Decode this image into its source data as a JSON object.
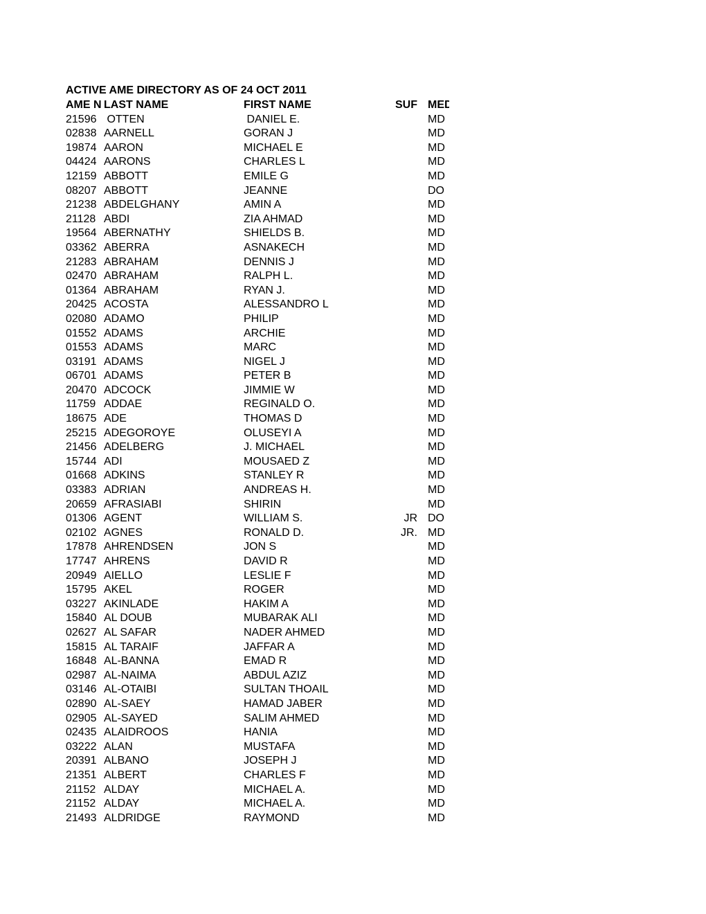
{
  "document": {
    "title": "ACTIVE AME DIRECTORY AS OF 24 OCT 2011",
    "columns": {
      "ame_no": "AME NO",
      "last_name": "LAST NAME",
      "first_name": "FIRST NAME",
      "suffix": "SUF",
      "medical_degree": "MED"
    },
    "rows": [
      {
        "ame_no": "21596",
        "last_name": " OTTEN",
        "first_name": " DANIEL E.",
        "suffix": "",
        "degree": "MD"
      },
      {
        "ame_no": "02838",
        "last_name": "AARNELL",
        "first_name": "GORAN J",
        "suffix": "",
        "degree": "MD"
      },
      {
        "ame_no": "19874",
        "last_name": "AARON",
        "first_name": "MICHAEL E",
        "suffix": "",
        "degree": "MD"
      },
      {
        "ame_no": "04424",
        "last_name": "AARONS",
        "first_name": "CHARLES L",
        "suffix": "",
        "degree": "MD"
      },
      {
        "ame_no": "12159",
        "last_name": "ABBOTT",
        "first_name": "EMILE G",
        "suffix": "",
        "degree": "MD"
      },
      {
        "ame_no": "08207",
        "last_name": "ABBOTT",
        "first_name": "JEANNE",
        "suffix": "",
        "degree": "DO"
      },
      {
        "ame_no": "21238",
        "last_name": "ABDELGHANY",
        "first_name": "AMIN A",
        "suffix": "",
        "degree": "MD"
      },
      {
        "ame_no": "21128",
        "last_name": "ABDI",
        "first_name": "ZIA AHMAD",
        "suffix": "",
        "degree": "MD"
      },
      {
        "ame_no": "19564",
        "last_name": "ABERNATHY",
        "first_name": "SHIELDS B.",
        "suffix": "",
        "degree": "MD"
      },
      {
        "ame_no": "03362",
        "last_name": "ABERRA",
        "first_name": "ASNAKECH",
        "suffix": "",
        "degree": "MD"
      },
      {
        "ame_no": "21283",
        "last_name": "ABRAHAM",
        "first_name": "DENNIS J",
        "suffix": "",
        "degree": "MD"
      },
      {
        "ame_no": "02470",
        "last_name": "ABRAHAM",
        "first_name": "RALPH L.",
        "suffix": "",
        "degree": "MD"
      },
      {
        "ame_no": "01364",
        "last_name": "ABRAHAM",
        "first_name": "RYAN J.",
        "suffix": "",
        "degree": "MD"
      },
      {
        "ame_no": "20425",
        "last_name": "ACOSTA",
        "first_name": "ALESSANDRO L",
        "suffix": "",
        "degree": "MD"
      },
      {
        "ame_no": "02080",
        "last_name": "ADAMO",
        "first_name": "PHILIP",
        "suffix": "",
        "degree": "MD"
      },
      {
        "ame_no": "01552",
        "last_name": "ADAMS",
        "first_name": "ARCHIE",
        "suffix": "",
        "degree": "MD"
      },
      {
        "ame_no": "01553",
        "last_name": "ADAMS",
        "first_name": "MARC",
        "suffix": "",
        "degree": "MD"
      },
      {
        "ame_no": "03191",
        "last_name": "ADAMS",
        "first_name": "NIGEL J",
        "suffix": "",
        "degree": "MD"
      },
      {
        "ame_no": "06701",
        "last_name": "ADAMS",
        "first_name": "PETER B",
        "suffix": "",
        "degree": "MD"
      },
      {
        "ame_no": "20470",
        "last_name": "ADCOCK",
        "first_name": "JIMMIE W",
        "suffix": "",
        "degree": "MD"
      },
      {
        "ame_no": "11759",
        "last_name": "ADDAE",
        "first_name": "REGINALD O.",
        "suffix": "",
        "degree": "MD"
      },
      {
        "ame_no": "18675",
        "last_name": "ADE",
        "first_name": "THOMAS D",
        "suffix": "",
        "degree": "MD"
      },
      {
        "ame_no": "25215",
        "last_name": "ADEGOROYE",
        "first_name": "OLUSEYI A",
        "suffix": "",
        "degree": "MD"
      },
      {
        "ame_no": "21456",
        "last_name": "ADELBERG",
        "first_name": "J. MICHAEL",
        "suffix": "",
        "degree": "MD"
      },
      {
        "ame_no": "15744",
        "last_name": "ADI",
        "first_name": "MOUSAED Z",
        "suffix": "",
        "degree": "MD"
      },
      {
        "ame_no": "01668",
        "last_name": "ADKINS",
        "first_name": "STANLEY R",
        "suffix": "",
        "degree": "MD"
      },
      {
        "ame_no": "03383",
        "last_name": "ADRIAN",
        "first_name": "ANDREAS H.",
        "suffix": "",
        "degree": "MD"
      },
      {
        "ame_no": "20659",
        "last_name": "AFRASIABI",
        "first_name": "SHIRIN",
        "suffix": "",
        "degree": "MD"
      },
      {
        "ame_no": "01306",
        "last_name": "AGENT",
        "first_name": "WILLIAM S.",
        "suffix": "JR",
        "degree": "DO"
      },
      {
        "ame_no": "02102",
        "last_name": "AGNES",
        "first_name": "RONALD D.",
        "suffix": "JR.",
        "degree": "MD"
      },
      {
        "ame_no": "17878",
        "last_name": "AHRENDSEN",
        "first_name": "JON S",
        "suffix": "",
        "degree": "MD"
      },
      {
        "ame_no": "17747",
        "last_name": "AHRENS",
        "first_name": "DAVID R",
        "suffix": "",
        "degree": "MD"
      },
      {
        "ame_no": "20949",
        "last_name": "AIELLO",
        "first_name": "LESLIE F",
        "suffix": "",
        "degree": "MD"
      },
      {
        "ame_no": "15795",
        "last_name": "AKEL",
        "first_name": "ROGER",
        "suffix": "",
        "degree": "MD"
      },
      {
        "ame_no": "03227",
        "last_name": "AKINLADE",
        "first_name": "HAKIM A",
        "suffix": "",
        "degree": "MD"
      },
      {
        "ame_no": "15840",
        "last_name": "AL DOUB",
        "first_name": "MUBARAK ALI",
        "suffix": "",
        "degree": "MD"
      },
      {
        "ame_no": "02627",
        "last_name": "AL SAFAR",
        "first_name": "NADER AHMED",
        "suffix": "",
        "degree": "MD"
      },
      {
        "ame_no": "15815",
        "last_name": "AL TARAIF",
        "first_name": "JAFFAR A",
        "suffix": "",
        "degree": "MD"
      },
      {
        "ame_no": "16848",
        "last_name": "AL-BANNA",
        "first_name": "EMAD R",
        "suffix": "",
        "degree": "MD"
      },
      {
        "ame_no": "02987",
        "last_name": "AL-NAIMA",
        "first_name": "ABDUL AZIZ",
        "suffix": "",
        "degree": "MD"
      },
      {
        "ame_no": "03146",
        "last_name": "AL-OTAIBI",
        "first_name": "SULTAN THOAIL",
        "suffix": "",
        "degree": "MD"
      },
      {
        "ame_no": "02890",
        "last_name": "AL-SAEY",
        "first_name": "HAMAD JABER",
        "suffix": "",
        "degree": "MD"
      },
      {
        "ame_no": "02905",
        "last_name": "AL-SAYED",
        "first_name": "SALIM AHMED",
        "suffix": "",
        "degree": "MD"
      },
      {
        "ame_no": "02435",
        "last_name": "ALAIDROOS",
        "first_name": "HANIA",
        "suffix": "",
        "degree": "MD"
      },
      {
        "ame_no": "03222",
        "last_name": "ALAN",
        "first_name": "MUSTAFA",
        "suffix": "",
        "degree": "MD"
      },
      {
        "ame_no": "20391",
        "last_name": "ALBANO",
        "first_name": "JOSEPH J",
        "suffix": "",
        "degree": "MD"
      },
      {
        "ame_no": "21351",
        "last_name": "ALBERT",
        "first_name": "CHARLES F",
        "suffix": "",
        "degree": "MD"
      },
      {
        "ame_no": "21152",
        "last_name": "ALDAY",
        "first_name": "MICHAEL A.",
        "suffix": "",
        "degree": "MD"
      },
      {
        "ame_no": "21152",
        "last_name": "ALDAY",
        "first_name": "MICHAEL A.",
        "suffix": "",
        "degree": "MD"
      },
      {
        "ame_no": "21493",
        "last_name": "ALDRIDGE",
        "first_name": "RAYMOND",
        "suffix": "",
        "degree": "MD"
      }
    ]
  }
}
